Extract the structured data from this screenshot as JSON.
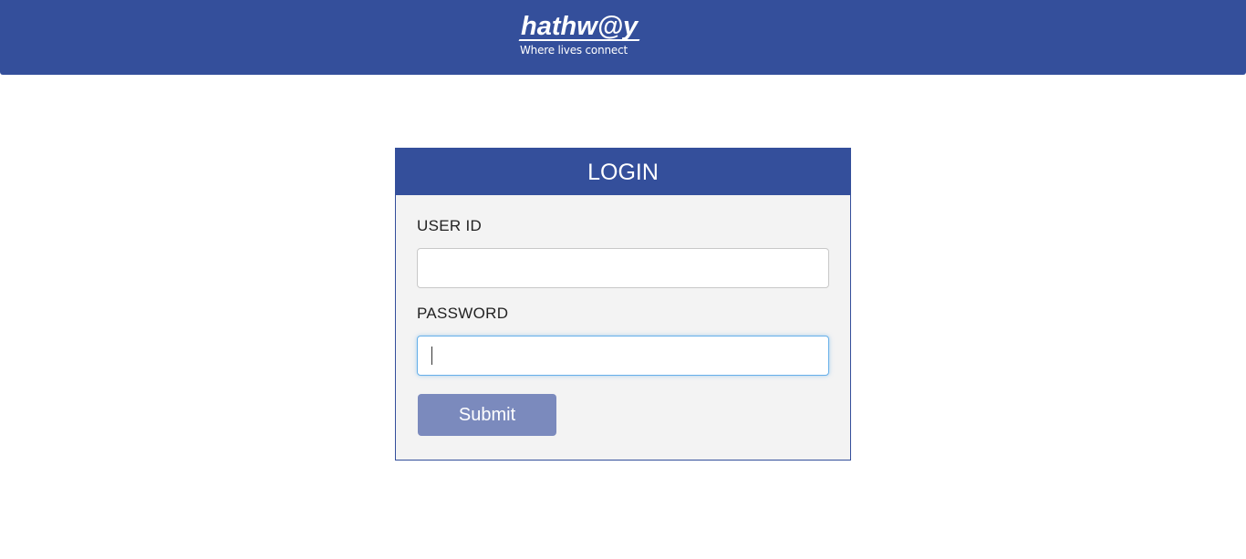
{
  "header": {
    "brand": "hathw@y",
    "tagline": "Where lives connect"
  },
  "login": {
    "title": "LOGIN",
    "user_id_label": "USER ID",
    "user_id_value": "",
    "password_label": "PASSWORD",
    "password_value": "",
    "submit_label": "Submit"
  },
  "colors": {
    "brand_blue": "#344f9b",
    "panel_bg": "#f3f3f3",
    "submit_bg": "#7b8abd",
    "focus_border": "#66afe9"
  }
}
